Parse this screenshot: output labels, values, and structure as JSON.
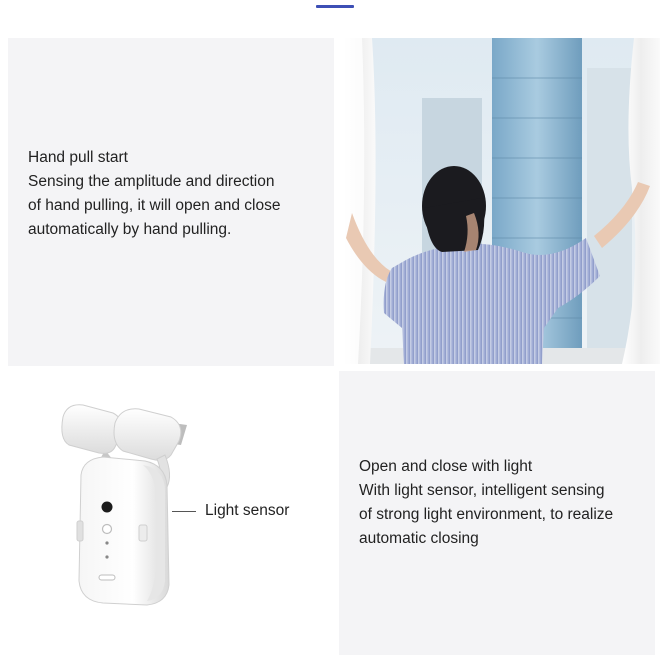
{
  "features": [
    {
      "title": "Hand pull start",
      "body_lines": [
        "Sensing the amplitude and direction",
        "of hand pulling, it will open and close",
        "automatically by hand pulling."
      ]
    },
    {
      "title": "Open and close with light",
      "body_lines": [
        "With light sensor, intelligent sensing",
        "of strong light environment, to realize",
        "automatic closing"
      ]
    }
  ],
  "device_callout": "Light sensor",
  "colors": {
    "accent": "#3d4fb5",
    "panel": "#f4f4f6"
  }
}
